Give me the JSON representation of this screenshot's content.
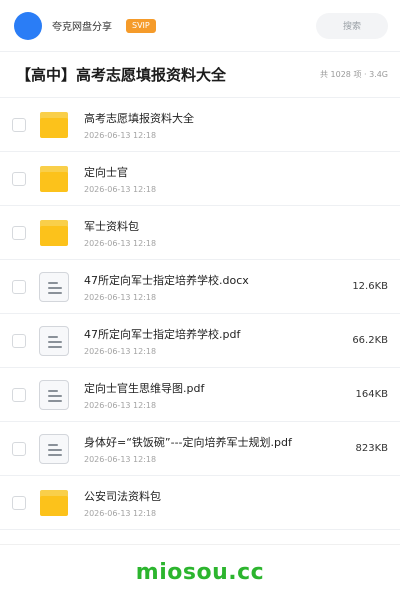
{
  "header": {
    "username": "夸克网盘分享",
    "badge": "SVIP",
    "search_placeholder": "搜索"
  },
  "title": {
    "text": "【高中】高考志愿填报资料大全",
    "count": "共 1028 项 · 3.4G"
  },
  "items": [
    {
      "type": "folder",
      "name": "高考志愿填报资料大全",
      "date": "2026-06-13 12:18",
      "size": ""
    },
    {
      "type": "folder",
      "name": "定向士官",
      "date": "2026-06-13 12:18",
      "size": ""
    },
    {
      "type": "folder",
      "name": "军士资料包",
      "date": "2026-06-13 12:18",
      "size": ""
    },
    {
      "type": "doc",
      "name": "47所定向军士指定培养学校.docx",
      "date": "2026-06-13 12:18",
      "size": "12.6KB"
    },
    {
      "type": "doc",
      "name": "47所定向军士指定培养学校.pdf",
      "date": "2026-06-13 12:18",
      "size": "66.2KB"
    },
    {
      "type": "doc",
      "name": "定向士官生思维导图.pdf",
      "date": "2026-06-13 12:18",
      "size": "164KB"
    },
    {
      "type": "doc",
      "name": "身体好=“铁饭碗”---定向培养军士规划.pdf",
      "date": "2026-06-13 12:18",
      "size": "823KB"
    },
    {
      "type": "folder",
      "name": "公安司法资料包",
      "date": "2026-06-13 12:18",
      "size": ""
    }
  ],
  "footer": {
    "brand": "miosou.cc"
  },
  "colors": {
    "accent": "#2a7df6",
    "badge": "#f59b2a",
    "folder": "#fcc21b",
    "brand": "#2cb52e"
  }
}
